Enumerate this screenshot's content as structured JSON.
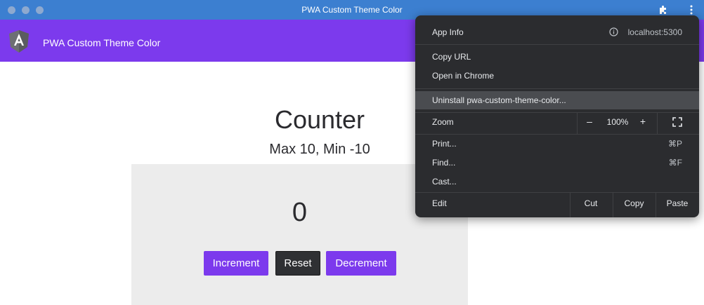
{
  "window": {
    "title": "PWA Custom Theme Color",
    "extensions_icon": "puzzle-icon",
    "menu_icon": "kebab-icon"
  },
  "toolbar": {
    "logo_icon": "angular-logo-icon",
    "app_title": "PWA Custom Theme Color",
    "color": "#7c3aed"
  },
  "counter": {
    "heading": "Counter",
    "subheading": "Max 10, Min -10",
    "value": "0",
    "increment_label": "Increment",
    "reset_label": "Reset",
    "decrement_label": "Decrement"
  },
  "menu": {
    "app_info_label": "App Info",
    "info_icon": "info-icon",
    "origin": "localhost:5300",
    "copy_url_label": "Copy URL",
    "open_in_chrome_label": "Open in Chrome",
    "uninstall_label": "Uninstall pwa-custom-theme-color...",
    "zoom_label": "Zoom",
    "zoom_out": "–",
    "zoom_value": "100%",
    "zoom_in": "+",
    "fullscreen_icon": "fullscreen-icon",
    "print_label": "Print...",
    "print_shortcut": "⌘P",
    "find_label": "Find...",
    "find_shortcut": "⌘F",
    "cast_label": "Cast...",
    "edit_label": "Edit",
    "cut_label": "Cut",
    "copy_label": "Copy",
    "paste_label": "Paste"
  }
}
